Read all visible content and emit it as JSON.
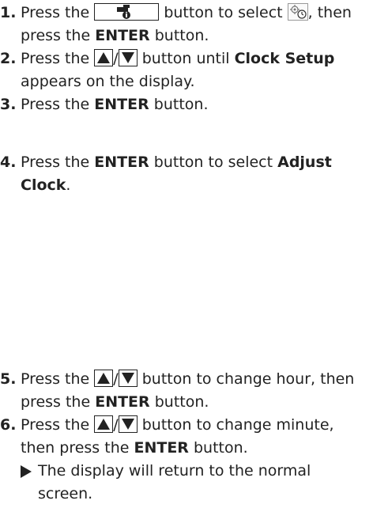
{
  "steps": [
    {
      "num": "1.",
      "t1": "Press the",
      "t2": "button to select",
      "t3": ", then press the",
      "bold1": "ENTER",
      "t4": "button."
    },
    {
      "num": "2.",
      "t1": "Press the",
      "sep": "/",
      "t2": "button until",
      "bold1": "Clock Setup",
      "t3": "appears on the display."
    },
    {
      "num": "3.",
      "t1": "Press the",
      "bold1": "ENTER",
      "t2": "button."
    },
    {
      "num": "4.",
      "t1": "Press the",
      "bold1": "ENTER",
      "t2": "button to select",
      "bold2": "Adjust Clock",
      "t3": "."
    },
    {
      "num": "5.",
      "t1": "Press the",
      "sep": "/",
      "t2": "button to change hour, then press the",
      "bold1": "ENTER",
      "t3": "button."
    },
    {
      "num": "6.",
      "t1": "Press the",
      "sep": "/",
      "t2": "button to change minute, then press the",
      "bold1": "ENTER",
      "t3": "button."
    }
  ],
  "note": "The display will return to the normal screen.",
  "icons": {
    "settings_button": "wrench-info-button-icon",
    "clock_settings_symbol": "gear-clock-icon",
    "up": "up-arrow-button-icon",
    "down": "down-arrow-button-icon",
    "note": "right-triangle-bullet-icon"
  }
}
